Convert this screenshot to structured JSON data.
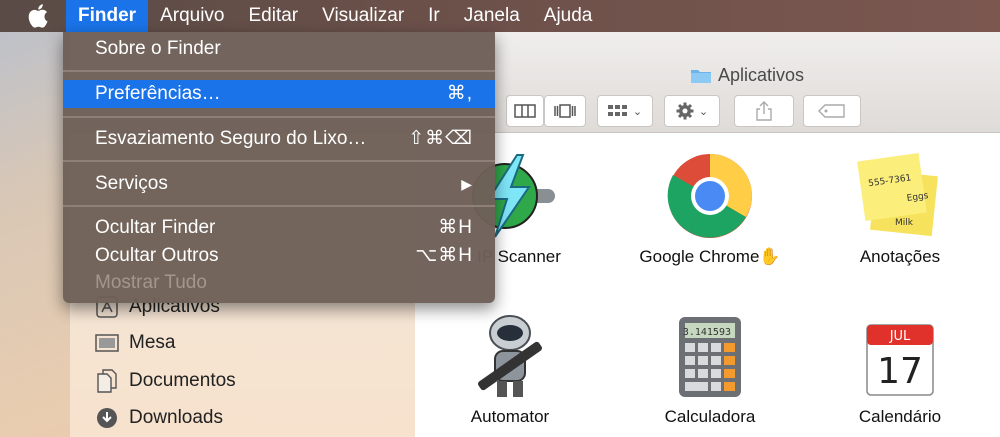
{
  "menubar": {
    "apple_icon": "apple-icon",
    "items": [
      "Finder",
      "Arquivo",
      "Editar",
      "Visualizar",
      "Ir",
      "Janela",
      "Ajuda"
    ]
  },
  "window": {
    "title": "Aplicativos"
  },
  "toolbar": {
    "icons": [
      "column-view-icon",
      "coverflow-view-icon",
      "arrange-icon",
      "gear-icon",
      "share-icon",
      "tag-icon"
    ]
  },
  "sidebar": {
    "items": [
      {
        "label": "Aplicativos",
        "icon": "applications-icon"
      },
      {
        "label": "Mesa",
        "icon": "desktop-icon"
      },
      {
        "label": "Documentos",
        "icon": "documents-icon"
      },
      {
        "label": "Downloads",
        "icon": "downloads-icon"
      }
    ]
  },
  "apps": [
    {
      "label": "IP Scanner",
      "icon": "ip-scanner-icon"
    },
    {
      "label": "Google Chrome",
      "icon": "chrome-icon"
    },
    {
      "label": "Anotações",
      "icon": "stickies-icon",
      "note_text": "555-7361",
      "note_text2": "Eggs",
      "note_text3": "Milk"
    },
    {
      "label": "Automator",
      "icon": "automator-icon"
    },
    {
      "label": "Calculadora",
      "icon": "calculator-icon",
      "display": "3.141593"
    },
    {
      "label": "Calendário",
      "icon": "calendar-icon",
      "month": "JUL",
      "day": "17"
    }
  ],
  "finder_menu": {
    "about": "Sobre o Finder",
    "preferences": "Preferências…",
    "preferences_shortcut": "⌘,",
    "secure_empty": "Esvaziamento Seguro do Lixo…",
    "secure_empty_shortcut": "⇧⌘⌫",
    "services": "Serviços",
    "services_arrow": "▶",
    "hide": "Ocultar Finder",
    "hide_shortcut": "⌘H",
    "hide_others": "Ocultar Outros",
    "hide_others_shortcut": "⌥⌘H",
    "show_all": "Mostrar Tudo"
  },
  "colors": {
    "highlight": "#1a73e8",
    "menu_bg": "#6e6058"
  }
}
